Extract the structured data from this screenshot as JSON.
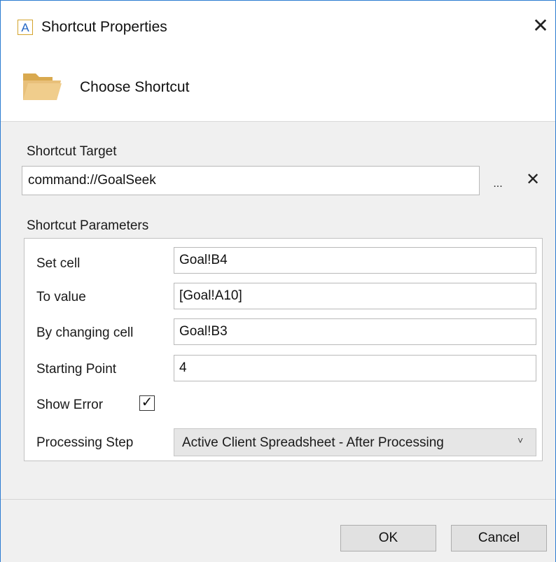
{
  "window": {
    "title": "Shortcut Properties",
    "app_icon_letter": "A",
    "close_glyph": "✕"
  },
  "header": {
    "title": "Choose Shortcut"
  },
  "target": {
    "label": "Shortcut Target",
    "value": "command://GoalSeek",
    "browse_label": "...",
    "clear_glyph": "✕"
  },
  "parameters": {
    "label": "Shortcut Parameters",
    "set_cell": {
      "label": "Set cell",
      "value": "Goal!B4"
    },
    "to_value": {
      "label": "To value",
      "value": "[Goal!A10]"
    },
    "changing_cell": {
      "label": "By changing cell",
      "value": "Goal!B3"
    },
    "starting_point": {
      "label": "Starting Point",
      "value": "4"
    },
    "show_error": {
      "label": "Show Error",
      "checked": true,
      "check_glyph": "✓"
    },
    "processing_step": {
      "label": "Processing Step",
      "value": "Active Client Spreadsheet - After Processing",
      "chevron": "˅"
    }
  },
  "buttons": {
    "ok": "OK",
    "cancel": "Cancel"
  },
  "colors": {
    "accent": "#2b7bd1",
    "folder": "#e8c07a",
    "app_icon_border": "#d3a32c"
  }
}
